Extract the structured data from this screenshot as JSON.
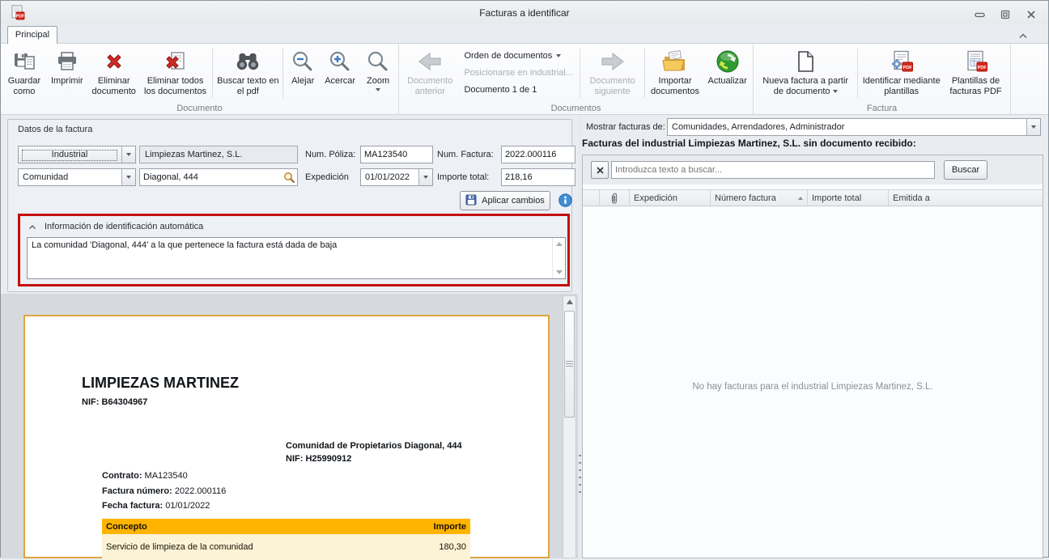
{
  "window": {
    "title": "Facturas a identificar"
  },
  "tabs": {
    "principal": "Principal"
  },
  "ribbon": {
    "buttons": {
      "guardar_como": "Guardar como",
      "imprimir": "Imprimir",
      "eliminar_documento": "Eliminar documento",
      "eliminar_todos": "Eliminar todos los documentos",
      "buscar_texto": "Buscar texto en el pdf",
      "alejar": "Alejar",
      "acercar": "Acercar",
      "zoom": "Zoom",
      "documento_anterior": "Documento anterior",
      "orden_documentos": "Orden de documentos",
      "posicionarse": "Posicionarse en industrial...",
      "documento_n": "Documento 1 de 1",
      "documento_siguiente": "Documento siguiente",
      "importar_documentos": "Importar documentos",
      "actualizar": "Actualizar",
      "nueva_factura": "Nueva factura a partir de documento",
      "identificar_plantillas": "Identificar mediante plantillas",
      "plantillas_pdf": "Plantillas de facturas PDF"
    },
    "groups": {
      "documento": "Documento",
      "documentos": "Documentos",
      "factura": "Factura"
    }
  },
  "datos_factura": {
    "title": "Datos de la factura",
    "industrial_selector": "Industrial",
    "industrial_value": "Limpiezas Martinez, S.L.",
    "comunidad_selector": "Comunidad",
    "comunidad_value": "Diagonal, 444",
    "num_poliza_label": "Num. Póliza:",
    "num_poliza_value": "MA123540",
    "expedicion_label": "Expedición",
    "expedicion_value": "01/01/2022",
    "num_factura_label": "Num. Factura:",
    "num_factura_value": "2022.000116",
    "importe_total_label": "Importe total:",
    "importe_total_value": "218,16",
    "aplicar_cambios": "Aplicar cambios"
  },
  "info_automatica": {
    "title": "Información de identificación automática",
    "message": "La comunidad 'Diagonal, 444' a la que pertenece la factura está dada de baja"
  },
  "invoice_preview": {
    "company_name": "LIMPIEZAS MARTINEZ",
    "company_nif": "NIF: B64304967",
    "client_name": "Comunidad de Propietarios Diagonal, 444",
    "client_nif": "NIF: H25990912",
    "contrato_label": "Contrato:",
    "contrato_value": " MA123540",
    "factura_numero_label": "Factura número:",
    "factura_numero_value": " 2022.000116",
    "fecha_factura_label": "Fecha factura:",
    "fecha_factura_value": " 01/01/2022",
    "table": {
      "concepto_header": "Concepto",
      "importe_header": "Importe",
      "row_concepto": "Servicio de limpieza de la comunidad",
      "row_importe": "180,30"
    }
  },
  "facturas_panel": {
    "mostrar_label": "Mostrar facturas de:",
    "mostrar_value": "Comunidades, Arrendadores, Administrador",
    "heading": "Facturas del industrial Limpiezas Martinez, S.L. sin documento recibido:",
    "search_placeholder": "Introduzca texto a buscar...",
    "buscar_button": "Buscar",
    "columns": [
      "Expedición",
      "Número factura",
      "Importe total",
      "Emitida a"
    ],
    "empty_message": "No hay facturas para el industrial Limpiezas Martinez, S.L."
  }
}
